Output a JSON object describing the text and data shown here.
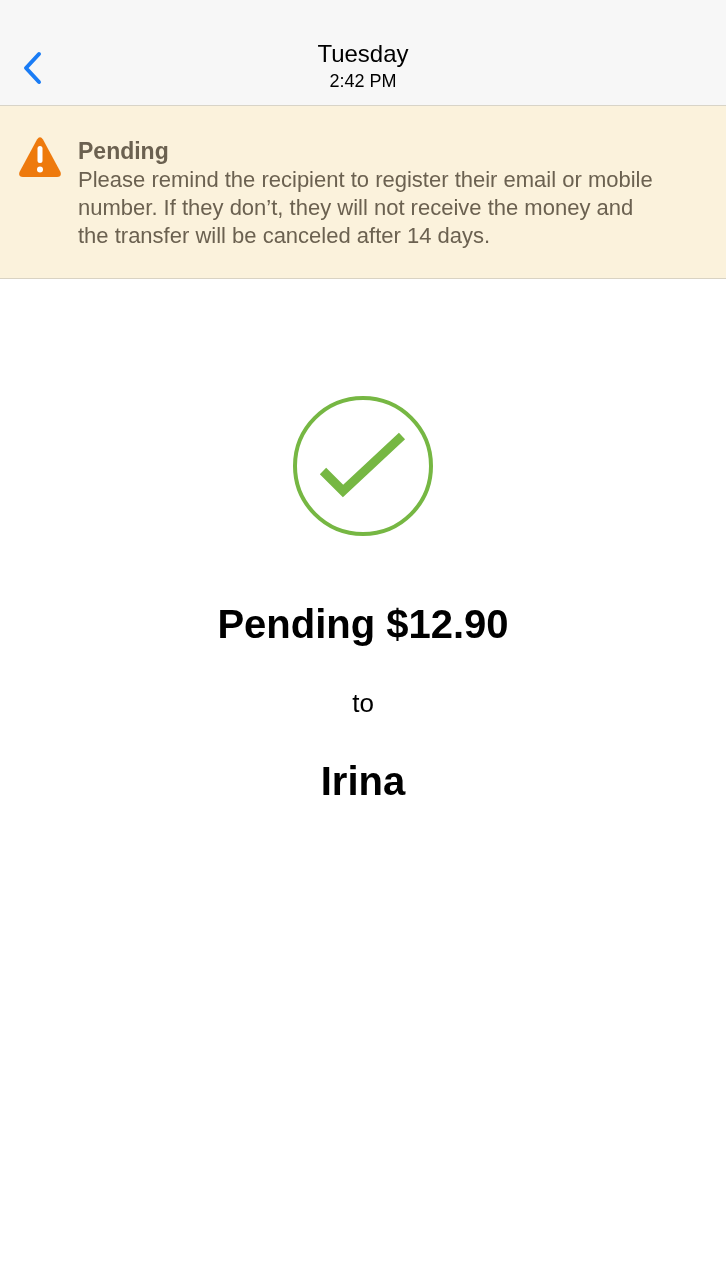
{
  "nav": {
    "title": "Tuesday",
    "subtitle": "2:42 PM"
  },
  "alert": {
    "kind": "warning",
    "title": "Pending",
    "message": "Please remind the recipient to register their email or mobile number. If they don’t, they will not receive the money and the transfer will be canceled after 14 days."
  },
  "result": {
    "kind": "success",
    "headline": "Pending $12.90",
    "connector": "to",
    "recipient": "Irina"
  }
}
